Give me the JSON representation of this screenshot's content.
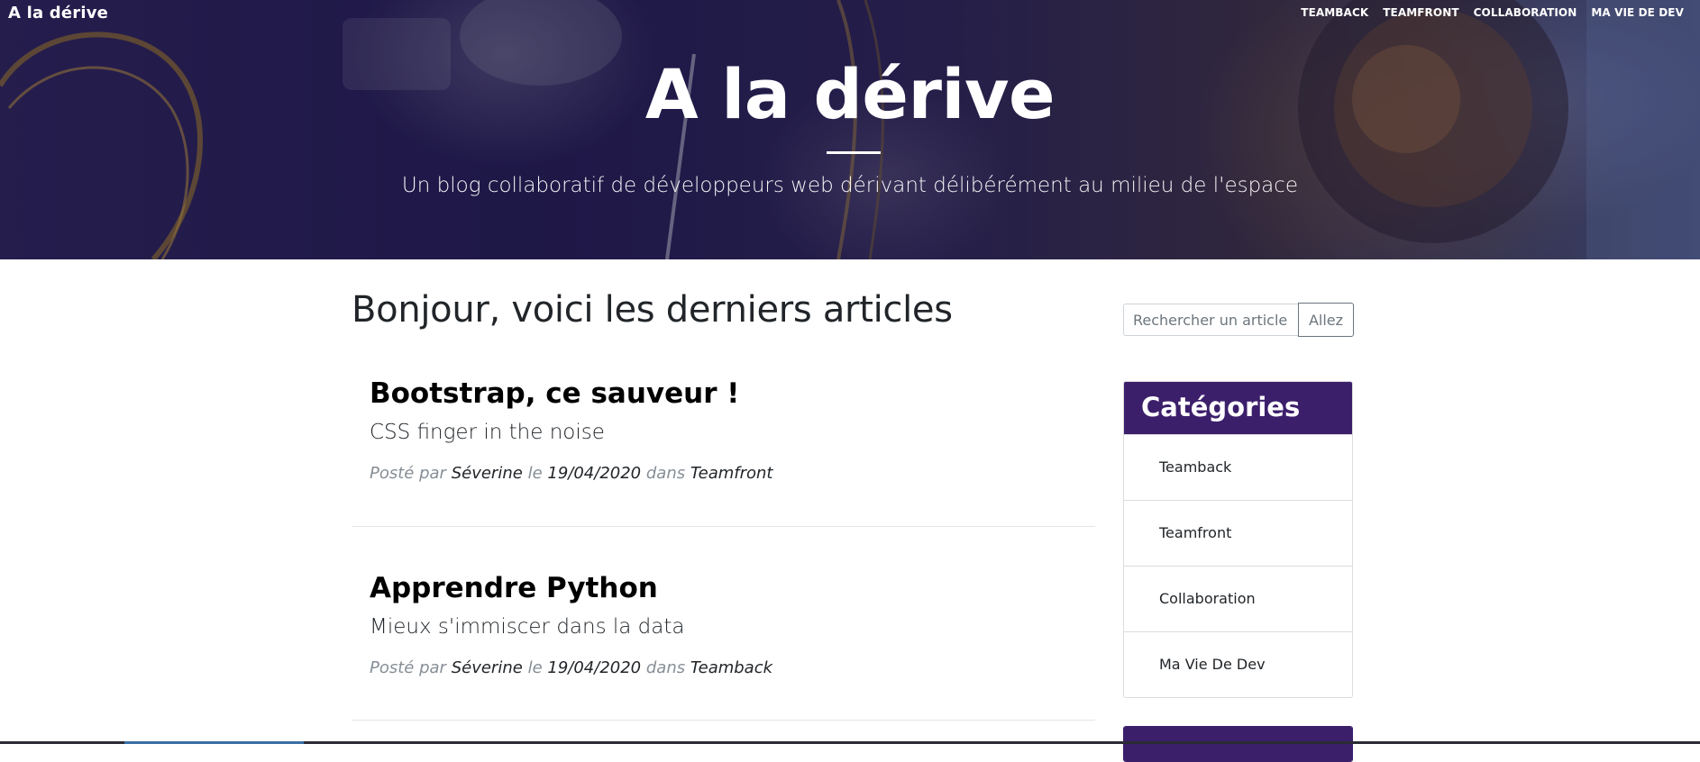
{
  "navbar": {
    "brand": "A la dérive",
    "links": [
      "Teamback",
      "Teamfront",
      "Collaboration",
      "Ma vie de dev"
    ]
  },
  "header": {
    "title": "A la dérive",
    "subtitle": "Un blog collaboratif de développeurs web dérivant délibérément au milieu de l'espace"
  },
  "main": {
    "heading": "Bonjour, voici les derniers articles",
    "posts": [
      {
        "title": "Bootstrap, ce sauveur !",
        "subtitle": "CSS finger in the noise",
        "posted_by": "Posté par",
        "author": "Séverine",
        "date_prefix": "le",
        "date": "19/04/2020",
        "category_prefix": "dans",
        "category": "Teamfront"
      },
      {
        "title": "Apprendre Python",
        "subtitle": "Mieux s'immiscer dans la data",
        "posted_by": "Posté par",
        "author": "Séverine",
        "date_prefix": "le",
        "date": "19/04/2020",
        "category_prefix": "dans",
        "category": "Teamback"
      }
    ]
  },
  "sidebar": {
    "search": {
      "placeholder": "Rechercher un article...",
      "button": "Allez"
    },
    "categories": {
      "title": "Catégories",
      "items": [
        "Teamback",
        "Teamfront",
        "Collaboration",
        "Ma Vie De Dev"
      ]
    }
  },
  "colors": {
    "accent": "#3c1f6b",
    "masthead": "#2b2254"
  }
}
